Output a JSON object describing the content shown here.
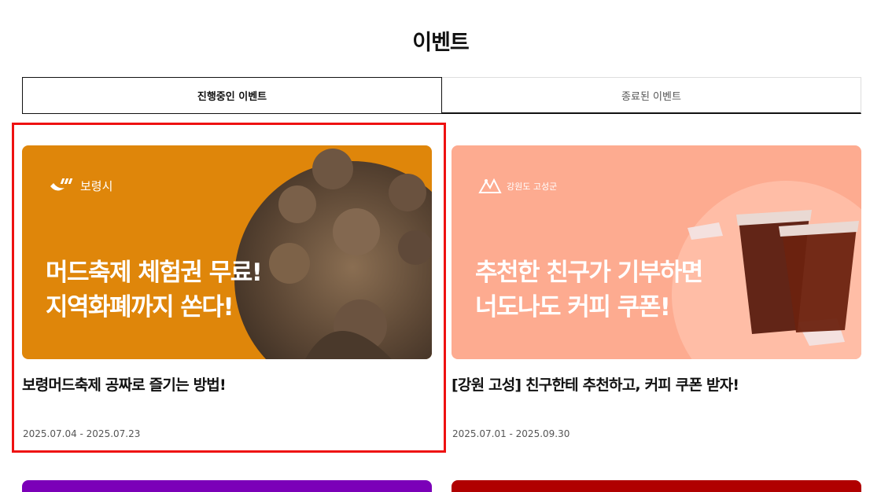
{
  "page": {
    "title": "이벤트"
  },
  "tabs": [
    {
      "label": "진행중인 이벤트",
      "active": true
    },
    {
      "label": "종료된 이벤트",
      "active": false
    }
  ],
  "events": [
    {
      "brand": "보령시",
      "banner_line1": "머드축제 체험권 무료!",
      "banner_line2": "지역화폐까지 쏜다!",
      "title": "보령머드축제 공짜로 즐기는 방법!",
      "period": "2025.07.04 - 2025.07.23",
      "color": "#df860a"
    },
    {
      "brand": "강원도 고성군",
      "banner_line1": "추천한 친구가 기부하면",
      "banner_line2": "너도나도 커피 쿠폰!",
      "title": "[강원 고성] 친구한테 추천하고, 커피 쿠폰 받자!",
      "period": "2025.07.01 - 2025.09.30",
      "color": "#fdab90"
    }
  ],
  "next_row_colors": [
    "#7b00b8",
    "#b00000"
  ],
  "highlight_color": "#ee1111"
}
